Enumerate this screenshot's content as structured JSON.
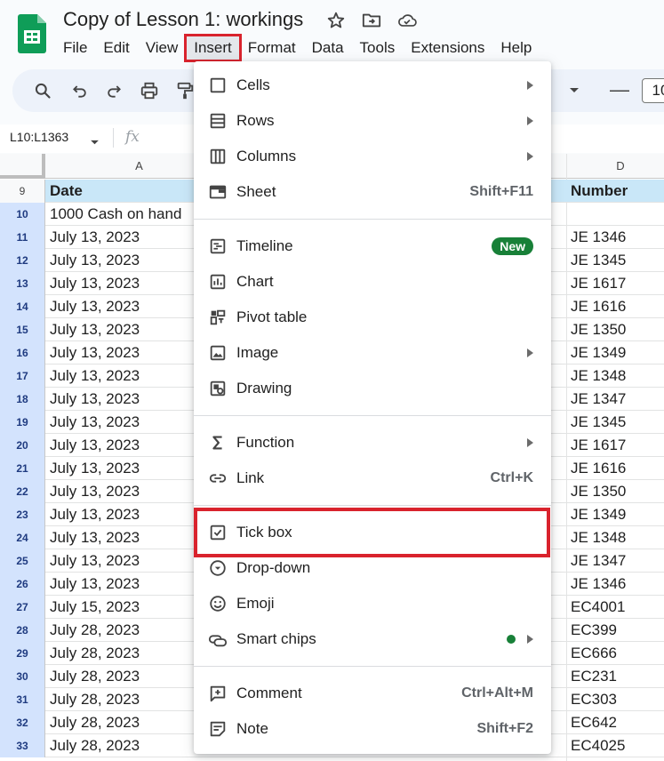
{
  "colors": {
    "brand_green": "#0f9d58",
    "highlight_red": "#d9232d",
    "header_fill": "#c9e7f8",
    "selected_row": "#d3e3fd",
    "badge_green": "#188038"
  },
  "doc": {
    "title": "Copy of Lesson 1: workings"
  },
  "menubar": [
    "File",
    "Edit",
    "View",
    "Insert",
    "Format",
    "Data",
    "Tools",
    "Extensions",
    "Help"
  ],
  "active_menu": "Insert",
  "toolbar": {
    "icons": [
      "search-icon",
      "undo-icon",
      "redo-icon",
      "print-icon",
      "paint-format-icon",
      "dropdown-caret-icon",
      "decrease-font-size-icon"
    ],
    "font_size": "10"
  },
  "formula_bar": {
    "name_box": "L10:L1363",
    "fx": "fx"
  },
  "grid": {
    "col_headers": [
      "A",
      "D"
    ],
    "header_row": {
      "num": "9",
      "a": "Date",
      "d": "Number"
    },
    "rows": [
      {
        "num": "10",
        "a": "1000 Cash on hand",
        "d": ""
      },
      {
        "num": "11",
        "a": "July 13, 2023",
        "d": "JE 1346"
      },
      {
        "num": "12",
        "a": "July 13, 2023",
        "d": "JE 1345"
      },
      {
        "num": "13",
        "a": "July 13, 2023",
        "d": "JE 1617"
      },
      {
        "num": "14",
        "a": "July 13, 2023",
        "d": "JE 1616"
      },
      {
        "num": "15",
        "a": "July 13, 2023",
        "d": "JE 1350"
      },
      {
        "num": "16",
        "a": "July 13, 2023",
        "d": "JE 1349"
      },
      {
        "num": "17",
        "a": "July 13, 2023",
        "d": "JE 1348"
      },
      {
        "num": "18",
        "a": "July 13, 2023",
        "d": "JE 1347"
      },
      {
        "num": "19",
        "a": "July 13, 2023",
        "d": "JE 1345"
      },
      {
        "num": "20",
        "a": "July 13, 2023",
        "d": "JE 1617"
      },
      {
        "num": "21",
        "a": "July 13, 2023",
        "d": "JE 1616"
      },
      {
        "num": "22",
        "a": "July 13, 2023",
        "d": "JE 1350"
      },
      {
        "num": "23",
        "a": "July 13, 2023",
        "d": "JE 1349"
      },
      {
        "num": "24",
        "a": "July 13, 2023",
        "d": "JE 1348"
      },
      {
        "num": "25",
        "a": "July 13, 2023",
        "d": "JE 1347"
      },
      {
        "num": "26",
        "a": "July 13, 2023",
        "d": "JE 1346"
      },
      {
        "num": "27",
        "a": "July 15, 2023",
        "d": "EC4001"
      },
      {
        "num": "28",
        "a": "July 28, 2023",
        "d": "EC399"
      },
      {
        "num": "29",
        "a": "July 28, 2023",
        "d": "EC666"
      },
      {
        "num": "30",
        "a": "July 28, 2023",
        "d": "EC231"
      },
      {
        "num": "31",
        "a": "July 28, 2023",
        "d": "EC303"
      },
      {
        "num": "32",
        "a": "July 28, 2023",
        "d": "EC642"
      },
      {
        "num": "33",
        "a": "July 28, 2023",
        "d": "EC4025"
      }
    ]
  },
  "insert_menu": {
    "groups": [
      [
        {
          "label": "Cells",
          "icon": "cells-icon",
          "submenu": true
        },
        {
          "label": "Rows",
          "icon": "rows-icon",
          "submenu": true
        },
        {
          "label": "Columns",
          "icon": "columns-icon",
          "submenu": true
        },
        {
          "label": "Sheet",
          "icon": "sheet-icon",
          "shortcut": "Shift+F11"
        }
      ],
      [
        {
          "label": "Timeline",
          "icon": "timeline-icon",
          "badge": "New"
        },
        {
          "label": "Chart",
          "icon": "chart-icon"
        },
        {
          "label": "Pivot table",
          "icon": "pivot-table-icon"
        },
        {
          "label": "Image",
          "icon": "image-icon",
          "submenu": true
        },
        {
          "label": "Drawing",
          "icon": "drawing-icon"
        }
      ],
      [
        {
          "label": "Function",
          "icon": "function-sigma-icon",
          "submenu": true
        },
        {
          "label": "Link",
          "icon": "link-icon",
          "shortcut": "Ctrl+K"
        }
      ],
      [
        {
          "label": "Tick box",
          "icon": "checkbox-icon",
          "highlighted": true
        },
        {
          "label": "Drop-down",
          "icon": "dropdown-chip-icon"
        },
        {
          "label": "Emoji",
          "icon": "emoji-icon"
        },
        {
          "label": "Smart chips",
          "icon": "smart-chips-icon",
          "submenu": true,
          "dot": true
        }
      ],
      [
        {
          "label": "Comment",
          "icon": "comment-icon",
          "shortcut": "Ctrl+Alt+M"
        },
        {
          "label": "Note",
          "icon": "note-icon",
          "shortcut": "Shift+F2"
        }
      ]
    ]
  }
}
